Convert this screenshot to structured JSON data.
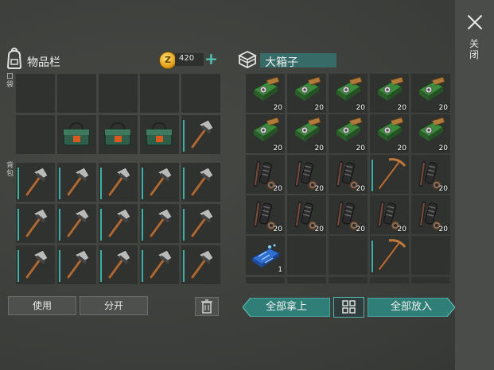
{
  "close": {
    "label": "关闭"
  },
  "inventory": {
    "title": "物品栏",
    "coins": "420",
    "pocket_label": "口袋",
    "backpack_label": "背包",
    "pocket_row1": [
      null,
      null,
      null,
      null,
      null
    ],
    "pocket_row2": [
      null,
      "medkit",
      "medkit",
      "medkit",
      "hammer"
    ],
    "backpack": [
      [
        "hammer",
        "hammer",
        "hammer",
        "hammer",
        "hammer"
      ],
      [
        "hammer",
        "hammer",
        "hammer",
        "hammer",
        "hammer"
      ],
      [
        "hammer",
        "hammer",
        "hammer",
        "hammer",
        "hammer"
      ]
    ],
    "use_label": "使用",
    "split_label": "分开"
  },
  "chest": {
    "title": "大箱子",
    "rows": [
      [
        {
          "item": "circuit",
          "qty": "20"
        },
        {
          "item": "circuit",
          "qty": "20"
        },
        {
          "item": "circuit",
          "qty": "20"
        },
        {
          "item": "circuit",
          "qty": "20"
        },
        {
          "item": "circuit",
          "qty": "20"
        }
      ],
      [
        {
          "item": "circuit",
          "qty": "20"
        },
        {
          "item": "circuit",
          "qty": "20"
        },
        {
          "item": "circuit",
          "qty": "20"
        },
        {
          "item": "circuit",
          "qty": "20"
        },
        {
          "item": "circuit",
          "qty": "20"
        }
      ],
      [
        {
          "item": "engine",
          "qty": "20"
        },
        {
          "item": "engine",
          "qty": "20"
        },
        {
          "item": "engine",
          "qty": "20"
        },
        {
          "item": "pickaxe",
          "qty": ""
        },
        {
          "item": "engine",
          "qty": "20"
        }
      ],
      [
        {
          "item": "engine",
          "qty": "20"
        },
        {
          "item": "engine",
          "qty": "20"
        },
        {
          "item": "engine",
          "qty": "20"
        },
        {
          "item": "engine",
          "qty": "20"
        },
        {
          "item": "engine",
          "qty": "20"
        }
      ],
      [
        {
          "item": "chip",
          "qty": "1"
        },
        {
          "item": null,
          "qty": ""
        },
        {
          "item": null,
          "qty": ""
        },
        {
          "item": "pickaxe",
          "qty": ""
        },
        {
          "item": null,
          "qty": ""
        }
      ]
    ],
    "take_all_label": "全部拿上",
    "put_all_label": "全部放入"
  },
  "colors": {
    "accent": "#4ec3b6",
    "button_teal": "#2f7f78"
  }
}
